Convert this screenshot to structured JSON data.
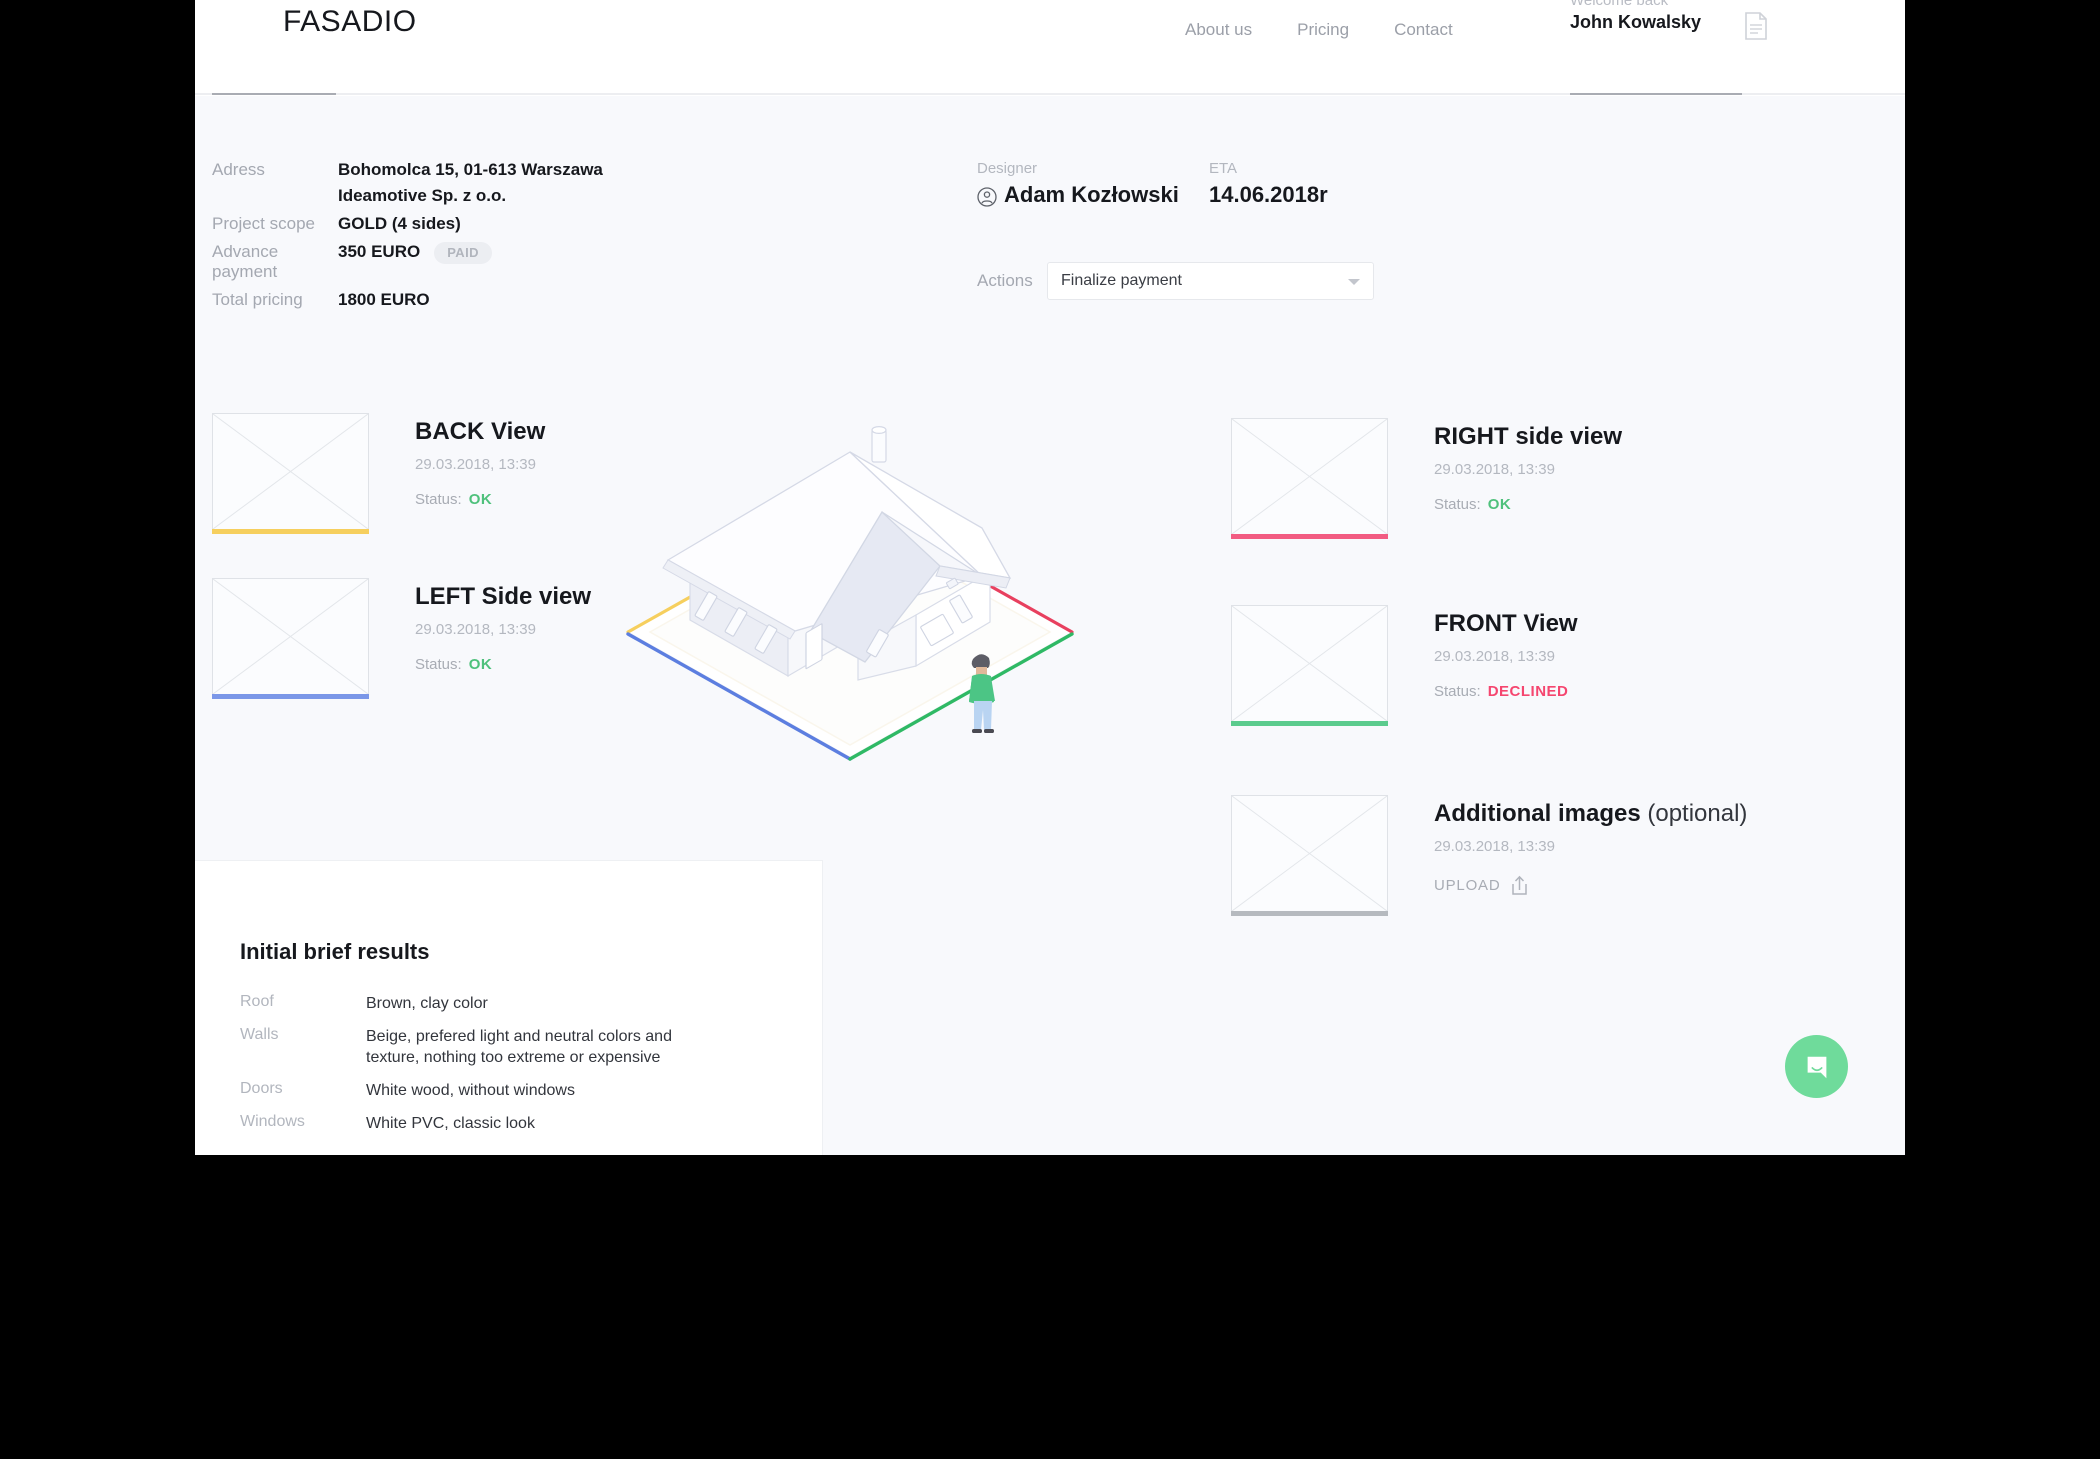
{
  "brand": {
    "logo": "FASADIO"
  },
  "nav": {
    "items": [
      {
        "label": "About us"
      },
      {
        "label": "Pricing"
      },
      {
        "label": "Contact"
      }
    ]
  },
  "user": {
    "welcome": "Welcome back",
    "name": "John Kowalsky",
    "doc_icon": "document-icon"
  },
  "project": {
    "address_label": "Adress",
    "address_line1": "Bohomolca 15, 01-613 Warszawa",
    "address_line2": "Ideamotive Sp. z o.o.",
    "scope_label": "Project scope",
    "scope_value": "GOLD (4 sides)",
    "advance_label": "Advance payment",
    "advance_value": "350 EURO",
    "advance_badge": "PAID",
    "total_label": "Total pricing",
    "total_value": "1800 EURO"
  },
  "designer": {
    "label": "Designer",
    "name": "Adam Kozłowski",
    "avatar_icon": "user-avatar-icon"
  },
  "eta": {
    "label": "ETA",
    "value": "14.06.2018r"
  },
  "actions": {
    "label": "Actions",
    "selected": "Finalize payment",
    "options": [
      "Finalize payment"
    ]
  },
  "views": {
    "back": {
      "title": "BACK View",
      "date": "29.03.2018, 13:39",
      "status_label": "Status:",
      "status": "OK",
      "accent": "#f6cf5e"
    },
    "left": {
      "title": "LEFT Side view",
      "date": "29.03.2018, 13:39",
      "status_label": "Status:",
      "status": "OK",
      "accent": "#7b97e8"
    },
    "right": {
      "title": "RIGHT side view",
      "date": "29.03.2018, 13:39",
      "status_label": "Status:",
      "status": "OK",
      "accent": "#f25c82"
    },
    "front": {
      "title": "FRONT View",
      "date": "29.03.2018, 13:39",
      "status_label": "Status:",
      "status": "DECLINED",
      "accent": "#5bcb8d"
    },
    "additional": {
      "title": "Additional images",
      "title_suffix": " (optional)",
      "date": "29.03.2018, 13:39",
      "upload_label": "UPLOAD",
      "upload_icon": "upload-icon",
      "accent": "#b6babf"
    }
  },
  "brief": {
    "title": "Initial brief results",
    "rows": [
      {
        "key": "Roof",
        "value": "Brown, clay color"
      },
      {
        "key": "Walls",
        "value": "Beige, prefered light and neutral colors and texture, nothing too extreme or expensive"
      },
      {
        "key": "Doors",
        "value": "White wood, without windows"
      },
      {
        "key": "Windows",
        "value": "White PVC, classic look"
      }
    ]
  },
  "chat": {
    "icon": "chat-bubble-icon",
    "color": "#6fdb9b"
  },
  "illustration": {
    "name": "isometric-house-illustration",
    "edge_colors": {
      "back": "#f6cf5e",
      "left": "#7b97e8",
      "front": "#3bbd6e",
      "right": "#e8405f"
    }
  }
}
